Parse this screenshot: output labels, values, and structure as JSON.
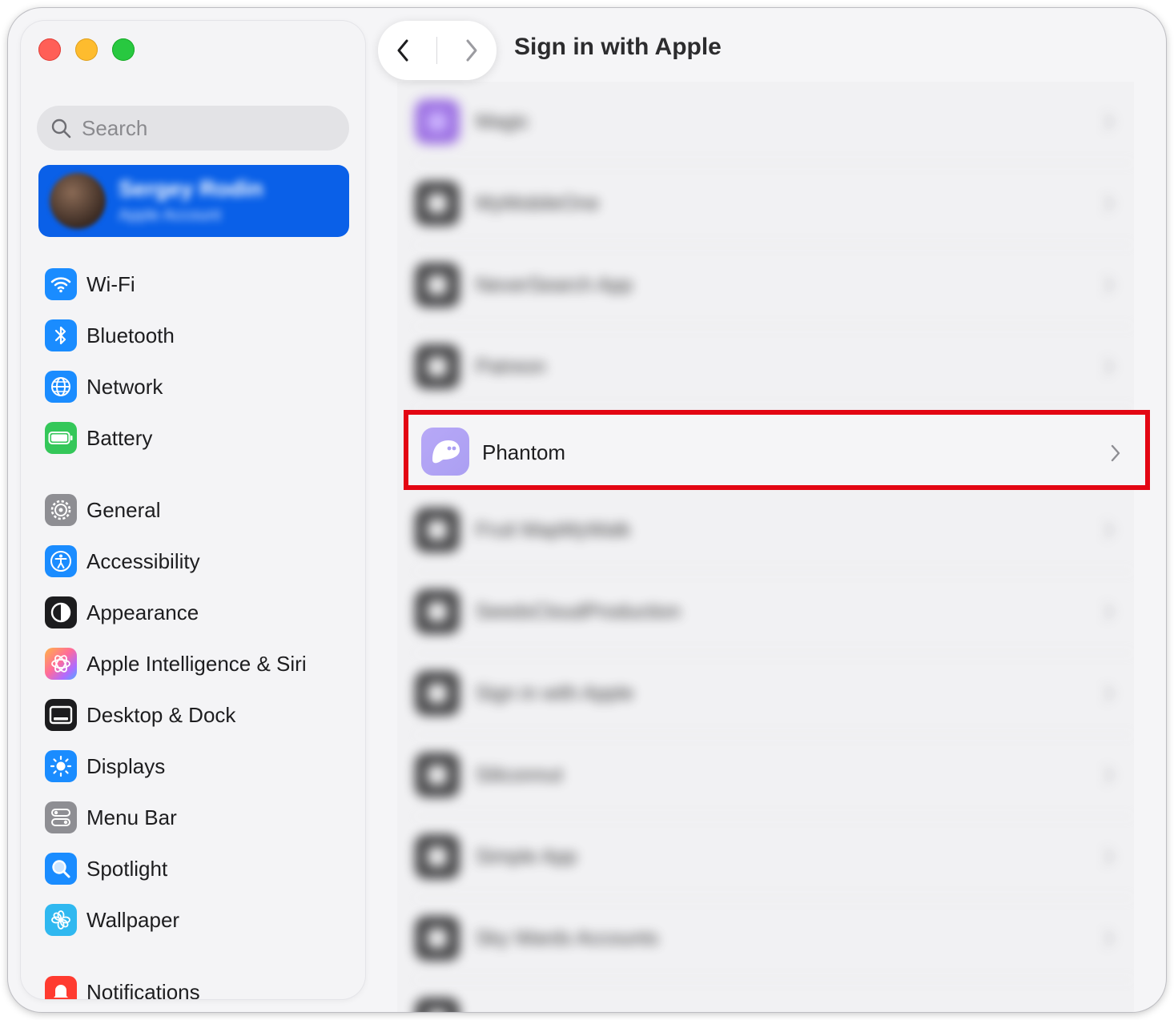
{
  "window": {
    "title": "Sign in with Apple"
  },
  "sidebar": {
    "search_placeholder": "Search",
    "account": {
      "name": "Sergey Rodin",
      "subtitle": "Apple Account"
    },
    "items": [
      {
        "label": "Wi-Fi",
        "icon": "wifi-icon",
        "color": "#1a8cff"
      },
      {
        "label": "Bluetooth",
        "icon": "bluetooth-icon",
        "color": "#1a8cff"
      },
      {
        "label": "Network",
        "icon": "globe-icon",
        "color": "#1a8cff"
      },
      {
        "label": "Battery",
        "icon": "battery-icon",
        "color": "#34c759"
      },
      {
        "label": "General",
        "icon": "gear-icon",
        "color": "#8e8e93"
      },
      {
        "label": "Accessibility",
        "icon": "accessibility-icon",
        "color": "#1a8cff"
      },
      {
        "label": "Appearance",
        "icon": "appearance-icon",
        "color": "#1c1c1e"
      },
      {
        "label": "Apple Intelligence & Siri",
        "icon": "siri-icon",
        "color": "#ff6b9a"
      },
      {
        "label": "Desktop & Dock",
        "icon": "dock-icon",
        "color": "#1c1c1e"
      },
      {
        "label": "Displays",
        "icon": "sun-icon",
        "color": "#1a8cff"
      },
      {
        "label": "Menu Bar",
        "icon": "menubar-icon",
        "color": "#8e8e93"
      },
      {
        "label": "Spotlight",
        "icon": "spotlight-icon",
        "color": "#1a8cff"
      },
      {
        "label": "Wallpaper",
        "icon": "flower-icon",
        "color": "#2fb8f0"
      },
      {
        "label": "Notifications",
        "icon": "bell-icon",
        "color": "#ff3b30"
      }
    ]
  },
  "apps": [
    {
      "name": "Magic"
    },
    {
      "name": "MyMobileOne"
    },
    {
      "name": "NeverSearch App"
    },
    {
      "name": "Patreon"
    },
    {
      "name": "Phantom",
      "highlighted": true
    },
    {
      "name": "Fruit MapMyWalk"
    },
    {
      "name": "SeedsCloudProduction"
    },
    {
      "name": "Sign in with Apple"
    },
    {
      "name": "Siliconnut"
    },
    {
      "name": "Simple App"
    },
    {
      "name": "Sky Wards Accounts"
    }
  ],
  "colors": {
    "accent": "#0a60e8",
    "highlight_border": "#e30613",
    "phantom_icon": "#ab9ff2"
  }
}
